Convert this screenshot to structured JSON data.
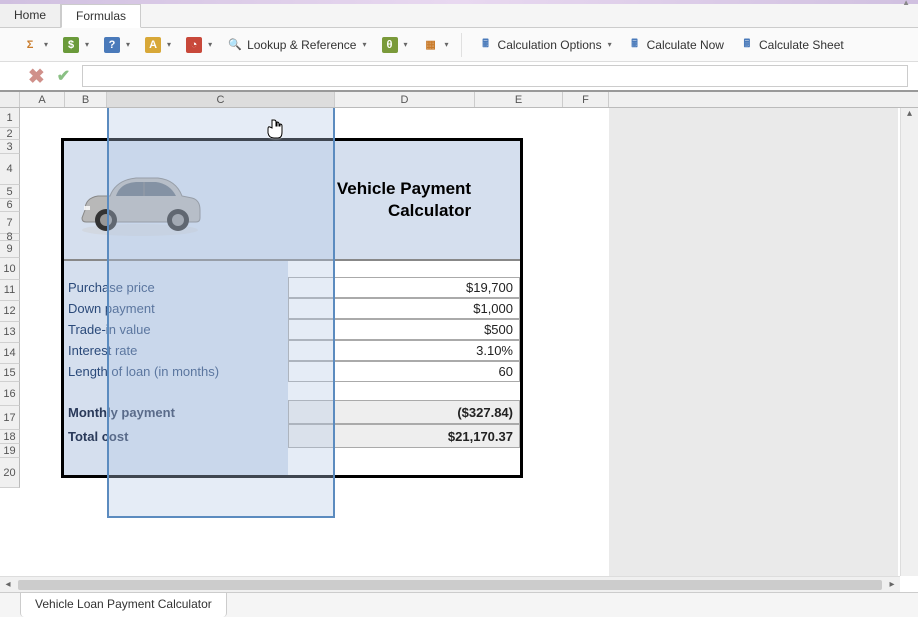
{
  "tabs": {
    "home": "Home",
    "formulas": "Formulas"
  },
  "ribbon": {
    "lookup": "Lookup & Reference",
    "calcOptions": "Calculation Options",
    "calcNow": "Calculate Now",
    "calcSheet": "Calculate Sheet"
  },
  "columns": {
    "A": "A",
    "B": "B",
    "C": "C",
    "D": "D",
    "E": "E",
    "F": "F"
  },
  "rows": [
    "1",
    "2",
    "3",
    "4",
    "5",
    "6",
    "7",
    "8",
    "9",
    "10",
    "11",
    "12",
    "13",
    "14",
    "15",
    "16",
    "17",
    "18",
    "19",
    "20"
  ],
  "doc": {
    "title1": "Vehicle Payment",
    "title2": "Calculator",
    "labels": {
      "purchase": "Purchase price",
      "down": "Down payment",
      "tradein": "Trade-in value",
      "interest": "Interest rate",
      "length": "Length of loan (in months)",
      "monthly": "Monthly payment",
      "total": "Total cost"
    },
    "values": {
      "purchase": "$19,700",
      "down": "$1,000",
      "tradein": "$500",
      "interest": "3.10%",
      "length": "60",
      "monthly": "($327.84)",
      "total": "$21,170.37"
    }
  },
  "sheetTab": "Vehicle Loan Payment Calculator",
  "formulaBar": ""
}
